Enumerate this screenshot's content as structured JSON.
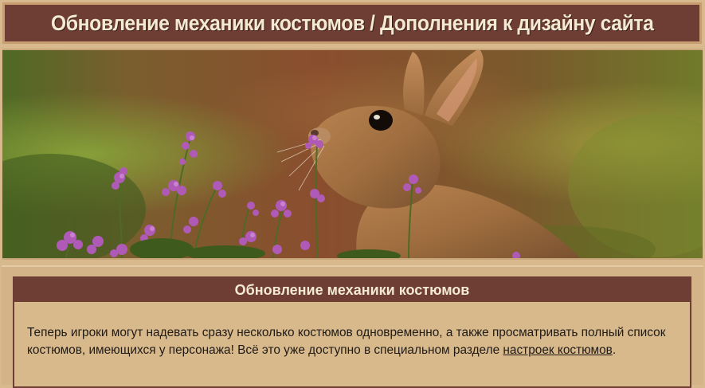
{
  "header": {
    "title": "Обновление механики костюмов / Дополнения к дизайну сайта"
  },
  "banner": {
    "image_description": "rabbit-sniffing-heather-flowers"
  },
  "news": {
    "title": "Обновление механики костюмов",
    "text_before_link": "Теперь игроки могут надевать сразу несколько костюмов одновременно, а также просматривать полный список костюмов, имеющихся у персонажа! Всё это уже доступно в специальном разделе ",
    "link_text": "настроек костюмов",
    "text_after_link": "."
  },
  "colors": {
    "header_bg": "#6e3d34",
    "header_text": "#f4ead2",
    "page_bg": "#d8b98d",
    "border_light": "#c89e70"
  }
}
